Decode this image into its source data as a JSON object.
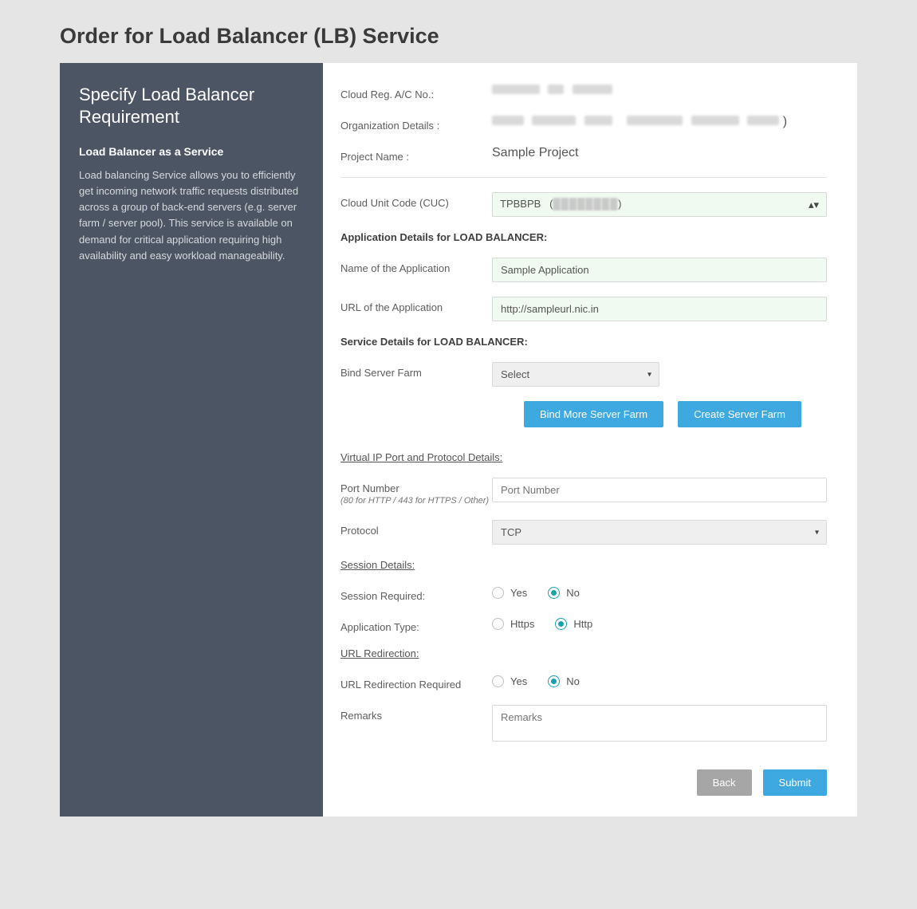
{
  "page_title": "Order for Load Balancer (LB) Service",
  "sidebar": {
    "heading": "Specify Load Balancer Requirement",
    "sub_heading": "Load Balancer as a Service",
    "description": "Load balancing Service allows you to efficiently get incoming network traffic requests distributed across a group of back-end servers (e.g. server farm / server pool). This service is available on demand for critical application requiring high availability and easy workload manageability."
  },
  "labels": {
    "cloud_reg": "Cloud Reg. A/C No.:",
    "org": "Organization Details :",
    "project": "Project Name :",
    "cuc": "Cloud Unit Code (CUC)",
    "app_details": "Application Details for LOAD BALANCER:",
    "app_name": "Name of the Application",
    "app_url": "URL of the Application",
    "svc_details": "Service Details for LOAD BALANCER:",
    "bind_farm": "Bind Server Farm",
    "bind_more": "Bind More Server Farm",
    "create_farm": "Create Server Farm",
    "vip": "Virtual IP Port and Protocol Details:",
    "port": "Port Number",
    "port_hint": "(80 for HTTP / 443 for HTTPS / Other)",
    "port_ph": "Port Number",
    "protocol": "Protocol",
    "session_head": "Session Details:",
    "session_req": "Session Required:",
    "app_type": "Application Type:",
    "url_redir_head": "URL Redirection:",
    "url_redir_req": "URL Redirection Required",
    "remarks": "Remarks",
    "remarks_ph": "Remarks",
    "back": "Back",
    "submit": "Submit",
    "yes": "Yes",
    "no": "No",
    "https": "Https",
    "http": "Http"
  },
  "values": {
    "project": "Sample Project",
    "cuc": "TPBBPB",
    "app_name": "Sample Application",
    "app_url": "http://sampleurl.nic.in",
    "bind_farm": "Select",
    "protocol": "TCP",
    "session_required": "No",
    "application_type": "Http",
    "url_redirection": "No"
  }
}
